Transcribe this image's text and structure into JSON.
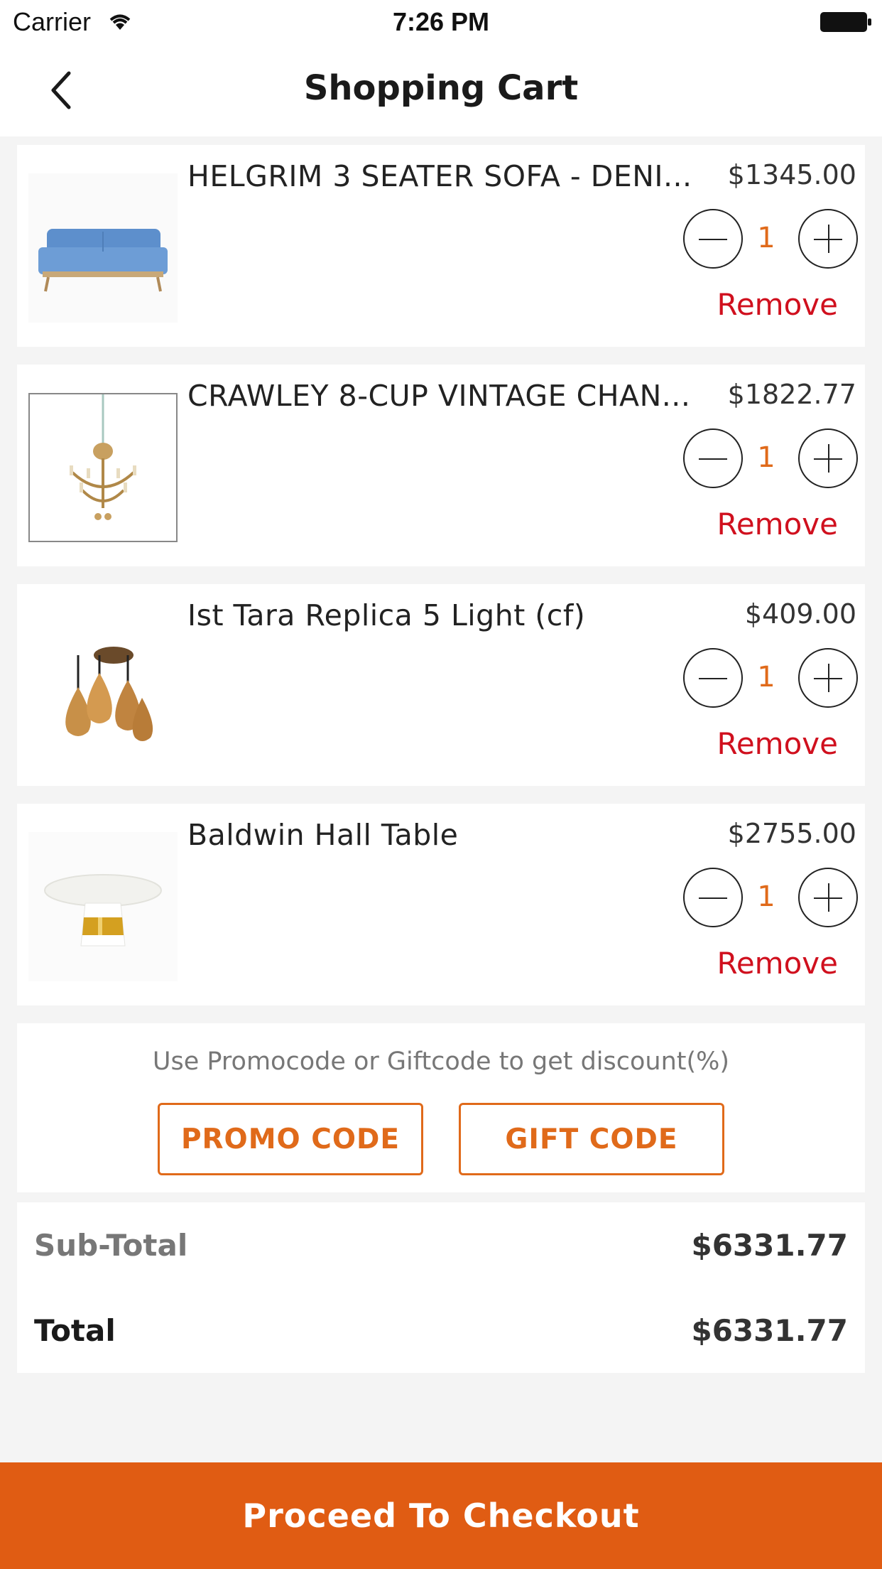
{
  "status_bar": {
    "carrier": "Carrier",
    "time": "7:26 PM"
  },
  "nav": {
    "title": "Shopping Cart"
  },
  "items": [
    {
      "name": "HELGRIM 3 SEATER SOFA - DENI...",
      "price": "$1345.00",
      "qty": "1",
      "remove": "Remove",
      "image": "sofa"
    },
    {
      "name": "CRAWLEY 8-CUP VINTAGE CHAN...",
      "price": "$1822.77",
      "qty": "1",
      "remove": "Remove",
      "image": "chandelier"
    },
    {
      "name": "Ist Tara Replica 5 Light (cf)",
      "price": "$409.00",
      "qty": "1",
      "remove": "Remove",
      "image": "pendant-lights"
    },
    {
      "name": "Baldwin Hall Table",
      "price": "$2755.00",
      "qty": "1",
      "remove": "Remove",
      "image": "hall-table"
    }
  ],
  "promo": {
    "text": "Use Promocode or Giftcode to get discount(%)",
    "promo_label": "PROMO CODE",
    "gift_label": "GIFT CODE"
  },
  "totals": {
    "subtotal_label": "Sub-Total",
    "subtotal_value": "$6331.77",
    "total_label": "Total",
    "total_value": "$6331.77"
  },
  "checkout": {
    "label": "Proceed To Checkout"
  },
  "colors": {
    "accent": "#e05c13",
    "remove": "#d0101e",
    "qty": "#e06a1a"
  }
}
